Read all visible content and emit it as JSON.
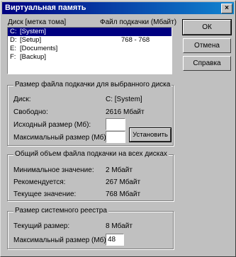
{
  "window": {
    "title": "Виртуальная память",
    "close_symbol": "×"
  },
  "buttons": {
    "ok": "ОК",
    "cancel": "Отмена",
    "help": "Справка",
    "set": "Установить"
  },
  "list": {
    "col_drive": "Диск [метка тома]",
    "col_pagefile": "Файл подкачки (Мбайт)",
    "rows": [
      {
        "drive": "C:",
        "label": "[System]",
        "size": "",
        "selected": true
      },
      {
        "drive": "D:",
        "label": "[Setup]",
        "size": "768 - 768",
        "selected": false
      },
      {
        "drive": "E:",
        "label": "[Documents]",
        "size": "",
        "selected": false
      },
      {
        "drive": "F:",
        "label": "[Backup]",
        "size": "",
        "selected": false
      }
    ]
  },
  "selected_drive": {
    "group_title": "Размер файла подкачки для выбранного диска",
    "drive_label": "Диск:",
    "drive_value": "C: [System]",
    "free_label": "Свободно:",
    "free_value": "2616 Мбайт",
    "initial_label": "Исходный размер (Мб):",
    "initial_value": "",
    "max_label": "Максимальный размер (Мб):",
    "max_value": ""
  },
  "total": {
    "group_title": "Общий объем файла подкачки на всех дисках",
    "min_label": "Минимальное значение:",
    "min_value": "2 Мбайт",
    "rec_label": "Рекомендуется:",
    "rec_value": "267 Мбайт",
    "cur_label": "Текущее значение:",
    "cur_value": "768 Мбайт"
  },
  "registry": {
    "group_title": "Размер системного реестра",
    "current_label": "Текущий размер:",
    "current_value": "8 Мбайт",
    "max_label": "Максимальный размер (Мб):",
    "max_value": "48"
  }
}
